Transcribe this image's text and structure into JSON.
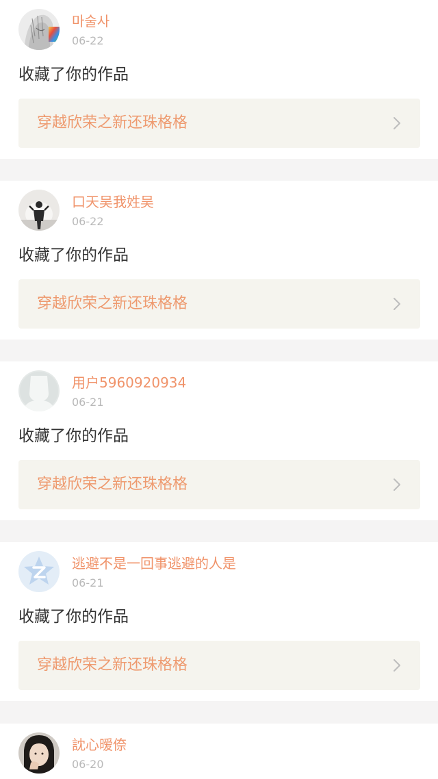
{
  "notifications": [
    {
      "username": "마술사",
      "date": "06-22",
      "action": "收藏了你的作品",
      "work_title": "穿越欣荣之新还珠格格",
      "avatar_icon": "anime-sketch-avatar"
    },
    {
      "username": "口天吴我姓吴",
      "date": "06-22",
      "action": "收藏了你的作品",
      "work_title": "穿越欣荣之新还珠格格",
      "avatar_icon": "person-silhouette-avatar"
    },
    {
      "username": "用户5960920934",
      "date": "06-21",
      "action": "收藏了你的作品",
      "work_title": "穿越欣荣之新还珠格格",
      "avatar_icon": "default-user-avatar"
    },
    {
      "username": "逃避不是一回事逃避的人是",
      "date": "06-21",
      "action": "收藏了你的作品",
      "work_title": "穿越欣荣之新还珠格格",
      "avatar_icon": "qzone-logo-avatar"
    },
    {
      "username": "訦心暧倷",
      "date": "06-20",
      "action": "",
      "work_title": "",
      "avatar_icon": "girl-photo-avatar"
    }
  ],
  "colors": {
    "username": "#f0936a",
    "work_title": "#ee9a6f",
    "date": "#b9b9b9",
    "action": "#333333",
    "link_bg": "#f5f4ee",
    "page_bg": "#f5f4f4"
  }
}
